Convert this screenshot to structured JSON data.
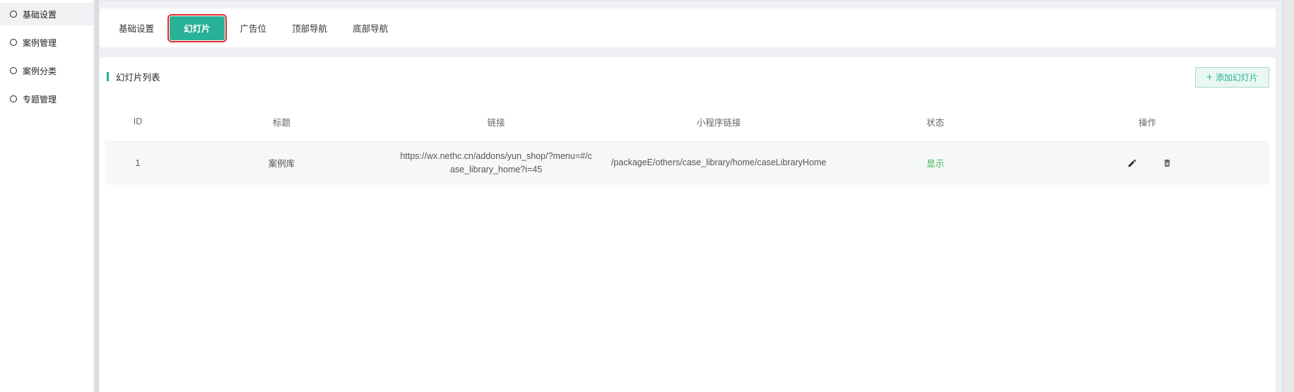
{
  "sidebar": {
    "items": [
      {
        "label": "基础设置",
        "active": true
      },
      {
        "label": "案例管理",
        "active": false
      },
      {
        "label": "案例分类",
        "active": false
      },
      {
        "label": "专题管理",
        "active": false
      }
    ]
  },
  "tabs": [
    {
      "label": "基础设置",
      "active": false
    },
    {
      "label": "幻灯片",
      "active": true
    },
    {
      "label": "广告位",
      "active": false
    },
    {
      "label": "顶部导航",
      "active": false
    },
    {
      "label": "底部导航",
      "active": false
    }
  ],
  "main": {
    "section_title": "幻灯片列表",
    "add_button": {
      "icon": "plus-icon",
      "label": "添加幻灯片"
    }
  },
  "table": {
    "headers": [
      "ID",
      "标题",
      "链接",
      "小程序链接",
      "状态",
      "操作"
    ],
    "rows": [
      {
        "id": "1",
        "title": "案例库",
        "link": "https://wx.nethc.cn/addons/yun_shop/?menu=#/case_library_home?i=45",
        "mini_link": "/packageE/others/case_library/home/caseLibraryHome",
        "status": "显示",
        "actions": [
          "edit-icon",
          "trash-icon"
        ]
      }
    ]
  },
  "colors": {
    "accent": "#29b197",
    "status_green": "#3bb34a",
    "highlight_border": "#e12b2b"
  }
}
